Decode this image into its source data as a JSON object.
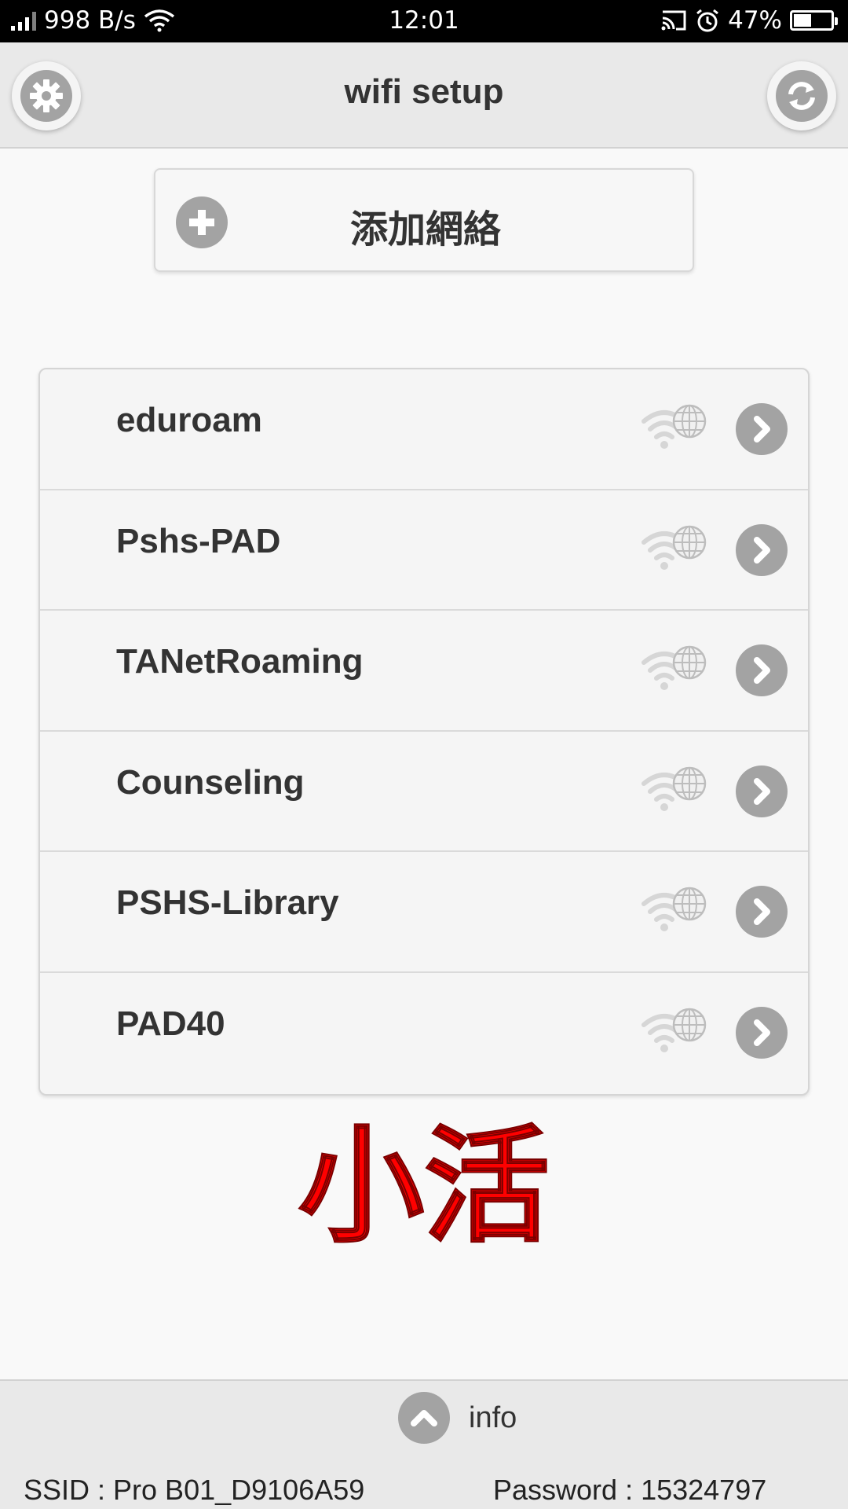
{
  "status_bar": {
    "speed": "998 B/s",
    "time": "12:01",
    "battery_percent": "47%",
    "battery_level": 0.47
  },
  "header": {
    "title": "wifi setup",
    "settings_icon": "gear-icon",
    "refresh_icon": "refresh-icon"
  },
  "add_network": {
    "label": "添加網絡",
    "icon": "plus-icon"
  },
  "networks": [
    {
      "name": "eduroam"
    },
    {
      "name": "Pshs-PAD"
    },
    {
      "name": "TANetRoaming"
    },
    {
      "name": "Counseling"
    },
    {
      "name": "PSHS-Library"
    },
    {
      "name": "PAD40"
    }
  ],
  "watermark": "小活",
  "footer": {
    "info_label": "info",
    "ssid_text": "SSID : Pro B01_D9106A59",
    "password_text": "Password : 15324797"
  },
  "colors": {
    "status_bar_bg": "#000000",
    "header_bg": "#e9e9e9",
    "icon_gray": "#a3a3a3",
    "watermark_red": "#ff0000"
  }
}
